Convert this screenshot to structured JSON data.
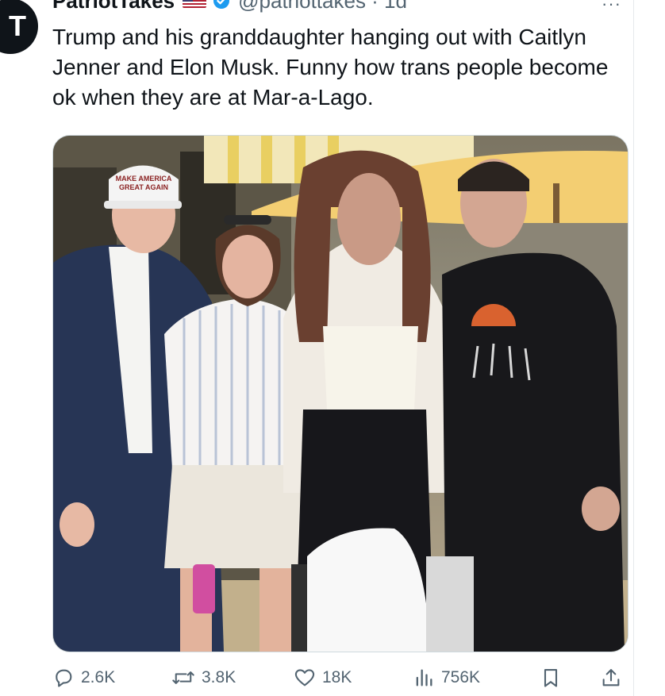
{
  "tweet": {
    "avatar_letter": "T",
    "display_name": "PatriotTakes",
    "flag_icon": "us-flag-icon",
    "verified_icon": "verified-badge-icon",
    "handle_time": "@patriottakes · 1d",
    "more_icon": "ellipsis-icon",
    "text": "Trump and his granddaughter hanging out with Caitlyn Jenner and Elon Musk. Funny how trans people become ok when they are at Mar-a-Lago.",
    "media_icon": "photo-of-four-people",
    "hat_text_line1": "MAKE AMERICA",
    "hat_text_line2": "GREAT AGAIN"
  },
  "actions": {
    "reply": {
      "icon": "reply-icon",
      "count": "2.6K"
    },
    "retweet": {
      "icon": "retweet-icon",
      "count": "3.8K"
    },
    "like": {
      "icon": "heart-icon",
      "count": "18K"
    },
    "views": {
      "icon": "views-chart-icon",
      "count": "756K"
    },
    "bookmark": {
      "icon": "bookmark-icon"
    },
    "share": {
      "icon": "share-icon"
    }
  },
  "colors": {
    "text": "#0f1419",
    "secondary": "#536471",
    "verified": "#1d9bf0",
    "border": "#cfd9de"
  }
}
